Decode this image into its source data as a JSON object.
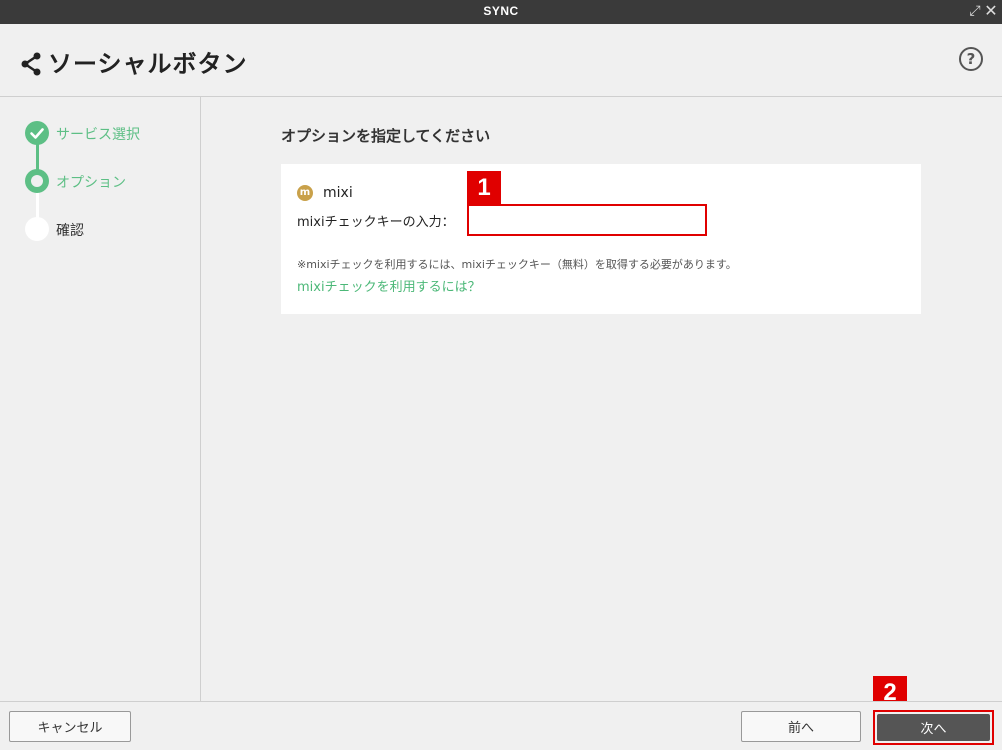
{
  "window": {
    "title": "SYNC"
  },
  "header": {
    "title": "ソーシャルボタン",
    "help_glyph": "?"
  },
  "steps": [
    {
      "label": "サービス選択",
      "state": "done"
    },
    {
      "label": "オプション",
      "state": "current"
    },
    {
      "label": "確認",
      "state": "todo"
    }
  ],
  "main": {
    "section_title": "オプションを指定してください",
    "service": {
      "icon_letter": "m",
      "name": "mixi",
      "field_label": "mixiチェックキーの入力：",
      "field_value": "",
      "note": "※mixiチェックを利用するには、mixiチェックキー（無料）を取得する必要があります。",
      "link": "mixiチェックを利用するには？"
    }
  },
  "annotations": {
    "badge1": "1",
    "badge2": "2"
  },
  "footer": {
    "cancel": "キャンセル",
    "prev": "前へ",
    "next": "次へ"
  },
  "colors": {
    "accent_green": "#5dbf85",
    "annotation_red": "#e00000",
    "mixi_gold": "#c9a14a"
  }
}
